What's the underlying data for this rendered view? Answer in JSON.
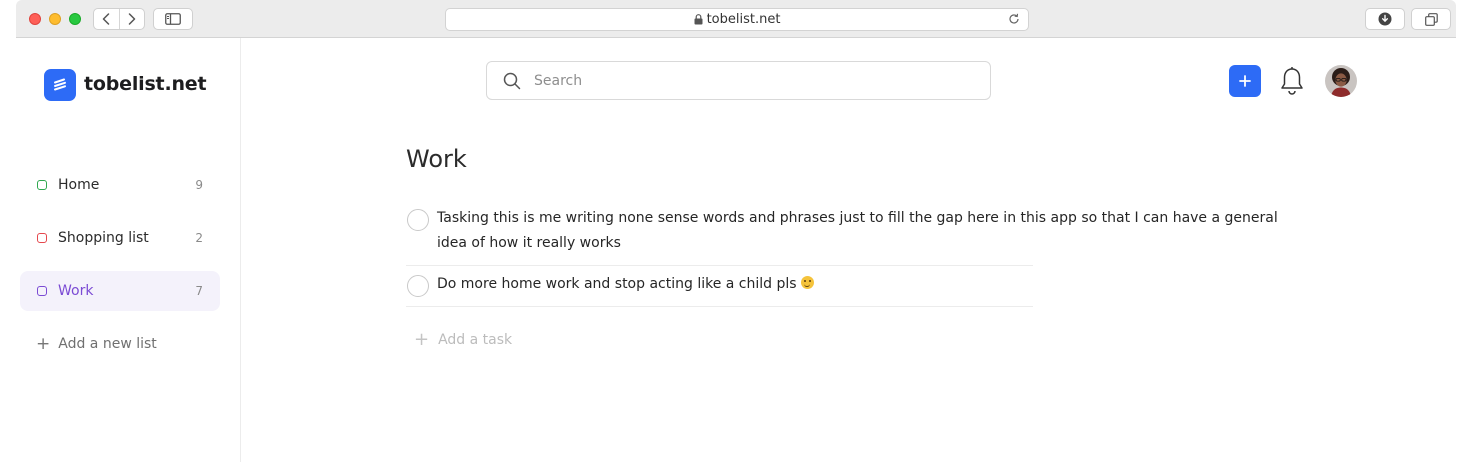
{
  "browser": {
    "url": "tobelist.net"
  },
  "app": {
    "brand": "tobelist.net"
  },
  "sidebar": {
    "items": [
      {
        "label": "Home",
        "count": "9",
        "color": "#2fa84f"
      },
      {
        "label": "Shopping list",
        "count": "2",
        "color": "#e5484d"
      },
      {
        "label": "Work",
        "count": "7",
        "color": "#7b4bd4",
        "active": true
      }
    ],
    "add_list_label": "Add a new list"
  },
  "header": {
    "search_placeholder": "Search",
    "add_icon": "plus-icon",
    "notification_icon": "bell-icon",
    "accent": "#2d6bf6"
  },
  "main": {
    "title": "Work",
    "tasks": [
      {
        "text": "Tasking this is me writing none sense words and phrases just to fill the gap here in this app so that I can have a general idea of how it really works"
      },
      {
        "text": "Do more home work and stop acting like a child pls",
        "emoji": "smiling-face"
      }
    ],
    "add_task_label": "Add a task"
  }
}
